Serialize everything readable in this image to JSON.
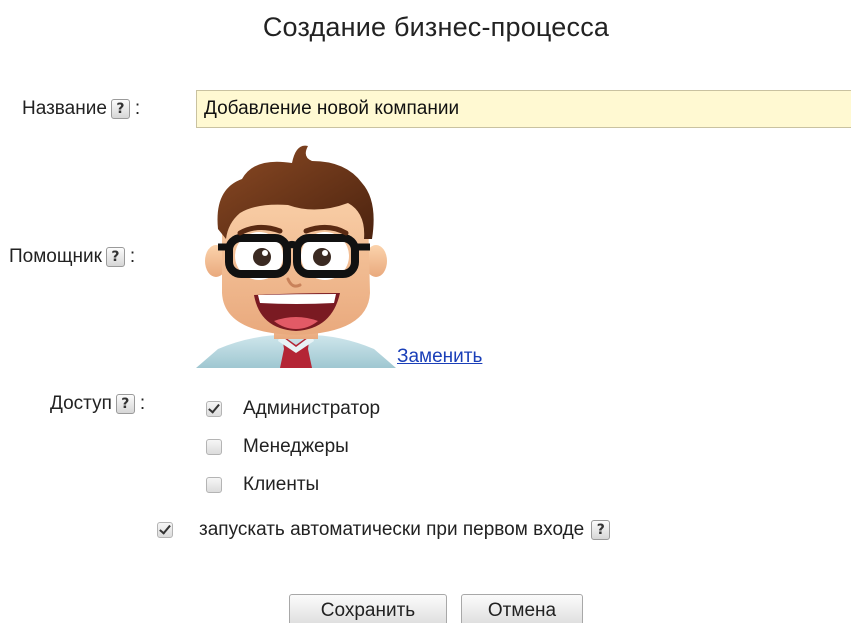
{
  "title": "Создание бизнес-процесса",
  "help_glyph": "?",
  "colon": ":",
  "name": {
    "label": "Название",
    "value": "Добавление новой компании"
  },
  "assistant": {
    "label": "Помощник",
    "replace_link": "Заменить"
  },
  "access": {
    "label": "Доступ",
    "options": [
      {
        "label": "Администратор",
        "checked": true
      },
      {
        "label": "Менеджеры",
        "checked": false
      },
      {
        "label": "Клиенты",
        "checked": false
      }
    ]
  },
  "autostart": {
    "label": "запускать автоматически при первом входе",
    "checked": true
  },
  "buttons": {
    "save": "Сохранить",
    "cancel": "Отмена"
  },
  "colors": {
    "input_bg": "#fff9d2",
    "link": "#1a3fb8"
  },
  "icons": {
    "help": "question-mark-icon",
    "check": "checkmark-icon"
  }
}
